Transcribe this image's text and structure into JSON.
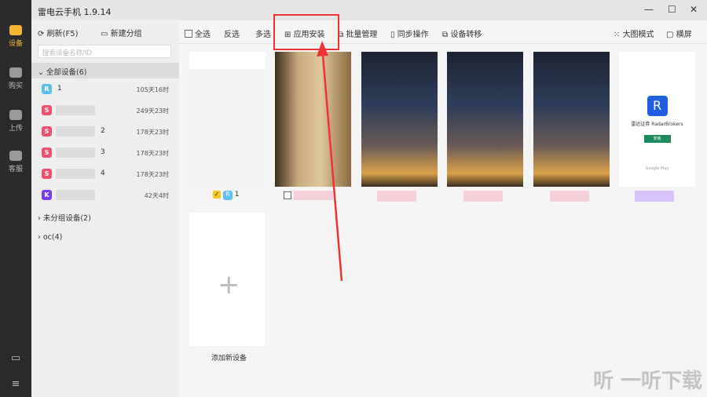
{
  "app": {
    "title": "雷电云手机 1.9.14",
    "min": "—",
    "max": "☐",
    "close": "✕"
  },
  "rail": [
    {
      "label": "设备",
      "icon": "device-icon"
    },
    {
      "label": "购买",
      "icon": "purchase-icon"
    },
    {
      "label": "上传",
      "icon": "upload-icon"
    },
    {
      "label": "客服",
      "icon": "support-icon"
    }
  ],
  "sidebar": {
    "refresh": "刷新(F5)",
    "new_group": "新建分组",
    "search_placeholder": "搜索设备名称/ID",
    "all_group": "全部设备(6)",
    "devices": [
      {
        "badge": "R",
        "name": "1",
        "time": "105天16时",
        "color": "#5bc0f0"
      },
      {
        "badge": "S",
        "name": "",
        "time": "249天23时",
        "color": "#f0506e"
      },
      {
        "badge": "S",
        "name": "2",
        "time": "178天23时",
        "color": "#f0506e"
      },
      {
        "badge": "S",
        "name": "3",
        "time": "178天23时",
        "color": "#f0506e"
      },
      {
        "badge": "S",
        "name": "4",
        "time": "178天23时",
        "color": "#f0506e"
      },
      {
        "badge": "K",
        "name": "",
        "time": "42天4时",
        "color": "#7a3cf0"
      }
    ],
    "ungrouped": "未分组设备(2)",
    "oc": "oc(4)"
  },
  "toolbar": {
    "select_all": "全选",
    "invert": "反选",
    "multi": "多选",
    "app_install": "应用安装",
    "batch": "批量管理",
    "sync": "同步操作",
    "transfer": "设备转移",
    "big_mode": "大图模式",
    "landscape": "横屏"
  },
  "cards": {
    "first_label": "1",
    "first_badge": "R",
    "ad_title": "雷达证券 RadarBrokers",
    "ad_logo": "R",
    "ad_button": "安装",
    "ad_store": "Google Play"
  },
  "add_device": "添加新设备",
  "watermark": "听 一听下载"
}
